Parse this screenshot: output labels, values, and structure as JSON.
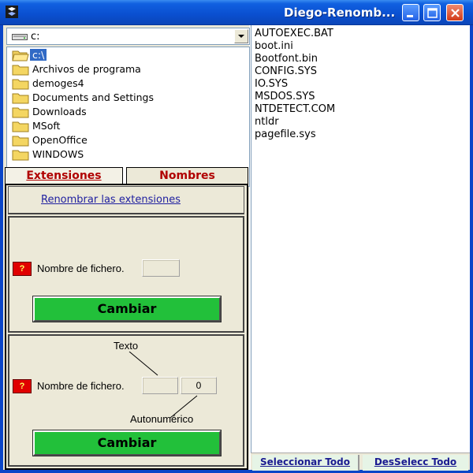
{
  "window": {
    "title": "Diego-Renomb..."
  },
  "drive": {
    "label": "c:"
  },
  "directories": [
    {
      "name": "c:\\",
      "selected": true
    },
    {
      "name": "Archivos de programa"
    },
    {
      "name": "demoges4"
    },
    {
      "name": "Documents and Settings"
    },
    {
      "name": "Downloads"
    },
    {
      "name": "MSoft"
    },
    {
      "name": "OpenOffice"
    },
    {
      "name": "WINDOWS"
    }
  ],
  "tabs": [
    {
      "label": "Extensiones",
      "active": true
    },
    {
      "label": "Nombres",
      "active": false
    }
  ],
  "extensions": {
    "link": "Renombrar las extensiones",
    "section1": {
      "help": "?",
      "label": "Nombre de fichero.",
      "value": "",
      "button": "Cambiar"
    },
    "section2": {
      "text_caption": "Texto",
      "help": "?",
      "label": "Nombre de fichero.",
      "text_value": "",
      "counter_value": "0",
      "auto_caption": "Autonumérico",
      "button": "Cambiar"
    }
  },
  "files": [
    "AUTOEXEC.BAT",
    "boot.ini",
    "Bootfont.bin",
    "CONFIG.SYS",
    "IO.SYS",
    "MSDOS.SYS",
    "NTDETECT.COM",
    "ntldr",
    "pagefile.sys"
  ],
  "footer": {
    "select_all": "Seleccionar Todo",
    "deselect_all": "DesSelecc Todo"
  },
  "colors": {
    "titlebar": "#0a4fd0",
    "tab_text": "#b00000",
    "button_green": "#22c03a",
    "help_red": "#e00000",
    "selection": "#316ac5"
  }
}
